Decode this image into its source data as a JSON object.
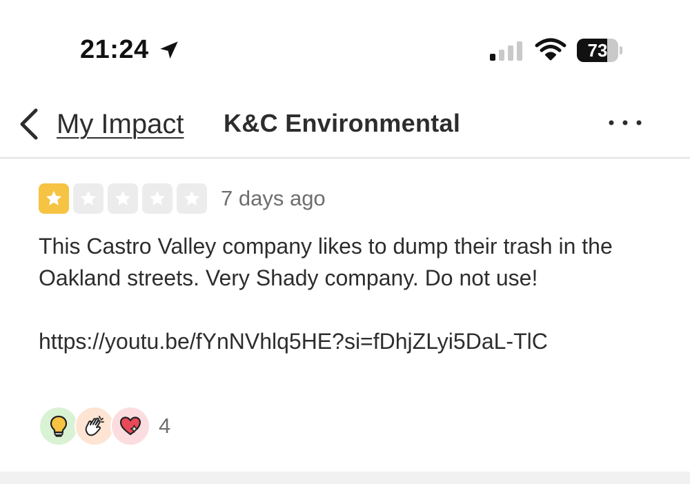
{
  "status_bar": {
    "time": "21:24",
    "battery_level": "73",
    "battery_fraction": 0.73,
    "icons": [
      "location-arrow-icon",
      "cellular-signal-icon",
      "wifi-icon",
      "battery-icon"
    ]
  },
  "nav": {
    "back_label": "My Impact",
    "title": "K&C Environmental",
    "more_icon": "more-dots-icon"
  },
  "review": {
    "rating": 1,
    "rating_max": 5,
    "time_ago": "7 days ago",
    "text": "This Castro Valley company likes to dump their trash in the Oakland streets. Very Shady company. Do not use!",
    "link": "https://youtu.be/fYnNVhlq5HE?si=fDhjZLyi5DaL-TlC",
    "reactions": {
      "icons": [
        "lightbulb-icon",
        "clapping-hands-icon",
        "heart-icon"
      ],
      "count": "4"
    }
  },
  "colors": {
    "star_filled": "#f6c343",
    "star_empty": "#ececec",
    "text": "#2d2d2d",
    "muted": "#6e6e6e"
  }
}
